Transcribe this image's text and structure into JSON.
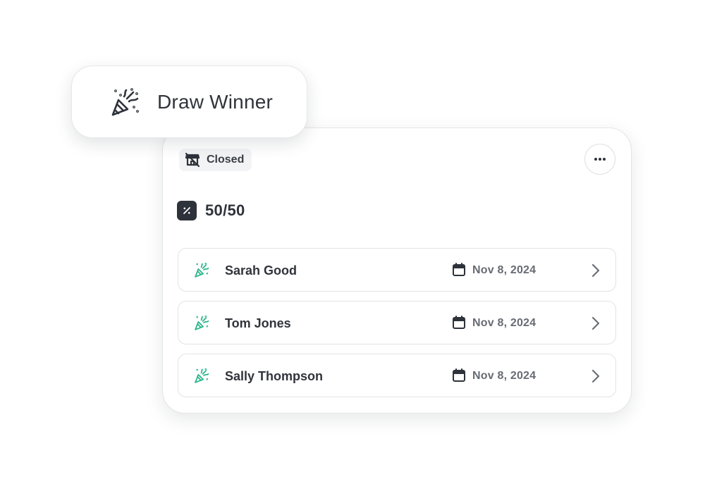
{
  "draw_button": {
    "label": "Draw Winner",
    "icon": "party-popper-icon"
  },
  "card": {
    "status": {
      "label": "Closed",
      "icon": "store-closed-icon"
    },
    "more_icon": "more-horizontal-icon",
    "title": "50/50",
    "title_icon": "percent-icon",
    "winners": [
      {
        "name": "Sarah Good",
        "date": "Nov 8, 2024"
      },
      {
        "name": "Tom Jones",
        "date": "Nov 8, 2024"
      },
      {
        "name": "Sally Thompson",
        "date": "Nov 8, 2024"
      }
    ]
  },
  "colors": {
    "accent_green": "#2bb58a",
    "dark": "#2e323a",
    "muted_text": "#676b73",
    "border": "#e2e3e6"
  }
}
